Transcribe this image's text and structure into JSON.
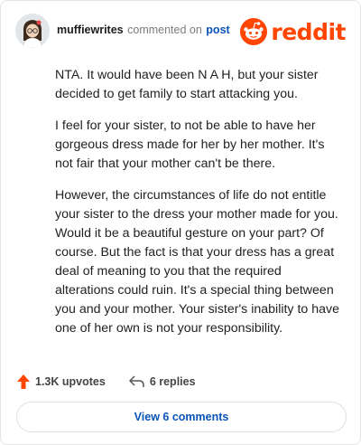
{
  "header": {
    "username": "muffiewrites",
    "action_text": "commented on",
    "target_link": "post",
    "brand": "reddit",
    "brand_color": "#ff4500",
    "avatar_icon": "avatar-icon"
  },
  "comment": {
    "paragraphs": [
      "NTA. It would have been N A H, but your sister decided to get family to start attacking you.",
      "I feel for your sister, to not be able to have her gorgeous dress made for her by her mother. It's not fair that your mother can't be there.",
      "However, the circumstances of life do not entitle your sister to the dress your mother made for you. Would it be a beautiful gesture on your part? Of course. But the fact is that your dress has a great deal of meaning to you that the required alterations could ruin. It's a special thing between you and your mother. Your sister's inability to have one of her own is not your responsibility."
    ]
  },
  "footer": {
    "upvotes": "1.3K upvotes",
    "replies": "6 replies",
    "upvote_icon": "upvote-arrow-icon",
    "reply_icon": "reply-icon"
  },
  "view_button": {
    "label": "View 6 comments"
  }
}
